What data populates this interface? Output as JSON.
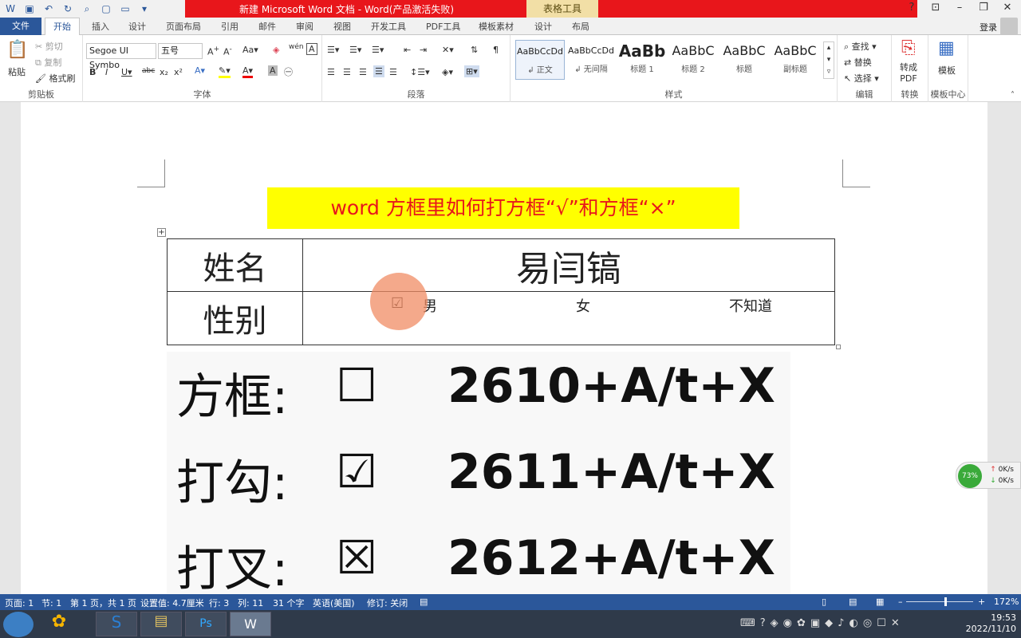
{
  "window": {
    "title": "新建 Microsoft Word 文档 - Word(产品激活失败)",
    "context_tab_group": "表格工具",
    "login": "登录"
  },
  "tabs": [
    "文件",
    "开始",
    "插入",
    "设计",
    "页面布局",
    "引用",
    "邮件",
    "审阅",
    "视图",
    "开发工具",
    "PDF工具",
    "模板素材",
    "设计",
    "布局"
  ],
  "ribbon": {
    "clipboard": {
      "paste": "粘贴",
      "cut": "剪切",
      "copy": "复制",
      "format_painter": "格式刷",
      "label": "剪贴板"
    },
    "font": {
      "name": "Segoe UI Symbo",
      "size": "五号",
      "label": "字体"
    },
    "paragraph": {
      "label": "段落"
    },
    "styles": {
      "label": "样式",
      "items": [
        {
          "sample": "AaBbCcDd",
          "name": "↲ 正文"
        },
        {
          "sample": "AaBbCcDd",
          "name": "↲ 无间隔"
        },
        {
          "sample": "AaBb",
          "name": "标题 1"
        },
        {
          "sample": "AaBbC",
          "name": "标题 2"
        },
        {
          "sample": "AaBbC",
          "name": "标题"
        },
        {
          "sample": "AaBbC",
          "name": "副标题"
        }
      ]
    },
    "editing": {
      "find": "查找",
      "replace": "替换",
      "select": "选择",
      "label": "编辑"
    },
    "convert": {
      "to_pdf": "转成\nPDF",
      "label": "转换"
    },
    "template": {
      "button": "模板",
      "label": "模板中心"
    }
  },
  "document": {
    "title": "word 方框里如何打方框“√”和方框“×”",
    "table": {
      "name_label": "姓名",
      "name_value": "易闫镐",
      "gender_label": "性别",
      "checkbox": "☑",
      "options": [
        "男",
        "女",
        "不知道"
      ]
    },
    "image_rows": [
      {
        "label": "方框:",
        "symbol": "☐",
        "code": "2610+A/t+X"
      },
      {
        "label": "打勾:",
        "symbol": "☑",
        "code": "2611+A/t+X"
      },
      {
        "label": "打叉:",
        "symbol": "☒",
        "code": "2612+A/t+X"
      }
    ]
  },
  "net_widget": {
    "percent": "73%",
    "up": "0K/s",
    "down": "0K/s"
  },
  "statusbar": {
    "page": "页面: 1",
    "section": "节: 1",
    "pages": "第 1 页，共 1 页",
    "position": "设置值: 4.7厘米",
    "row": "行: 3",
    "col": "列: 11",
    "chars": "31 个字",
    "lang": "英语(美国)",
    "track": "修订: 关闭",
    "zoom": "172%"
  },
  "taskbar": {
    "time": "19:53",
    "date": "2022/11/10"
  },
  "colors": {
    "accent": "#2b579a",
    "title_red": "#e8161b",
    "highlight": "#ffff00"
  }
}
